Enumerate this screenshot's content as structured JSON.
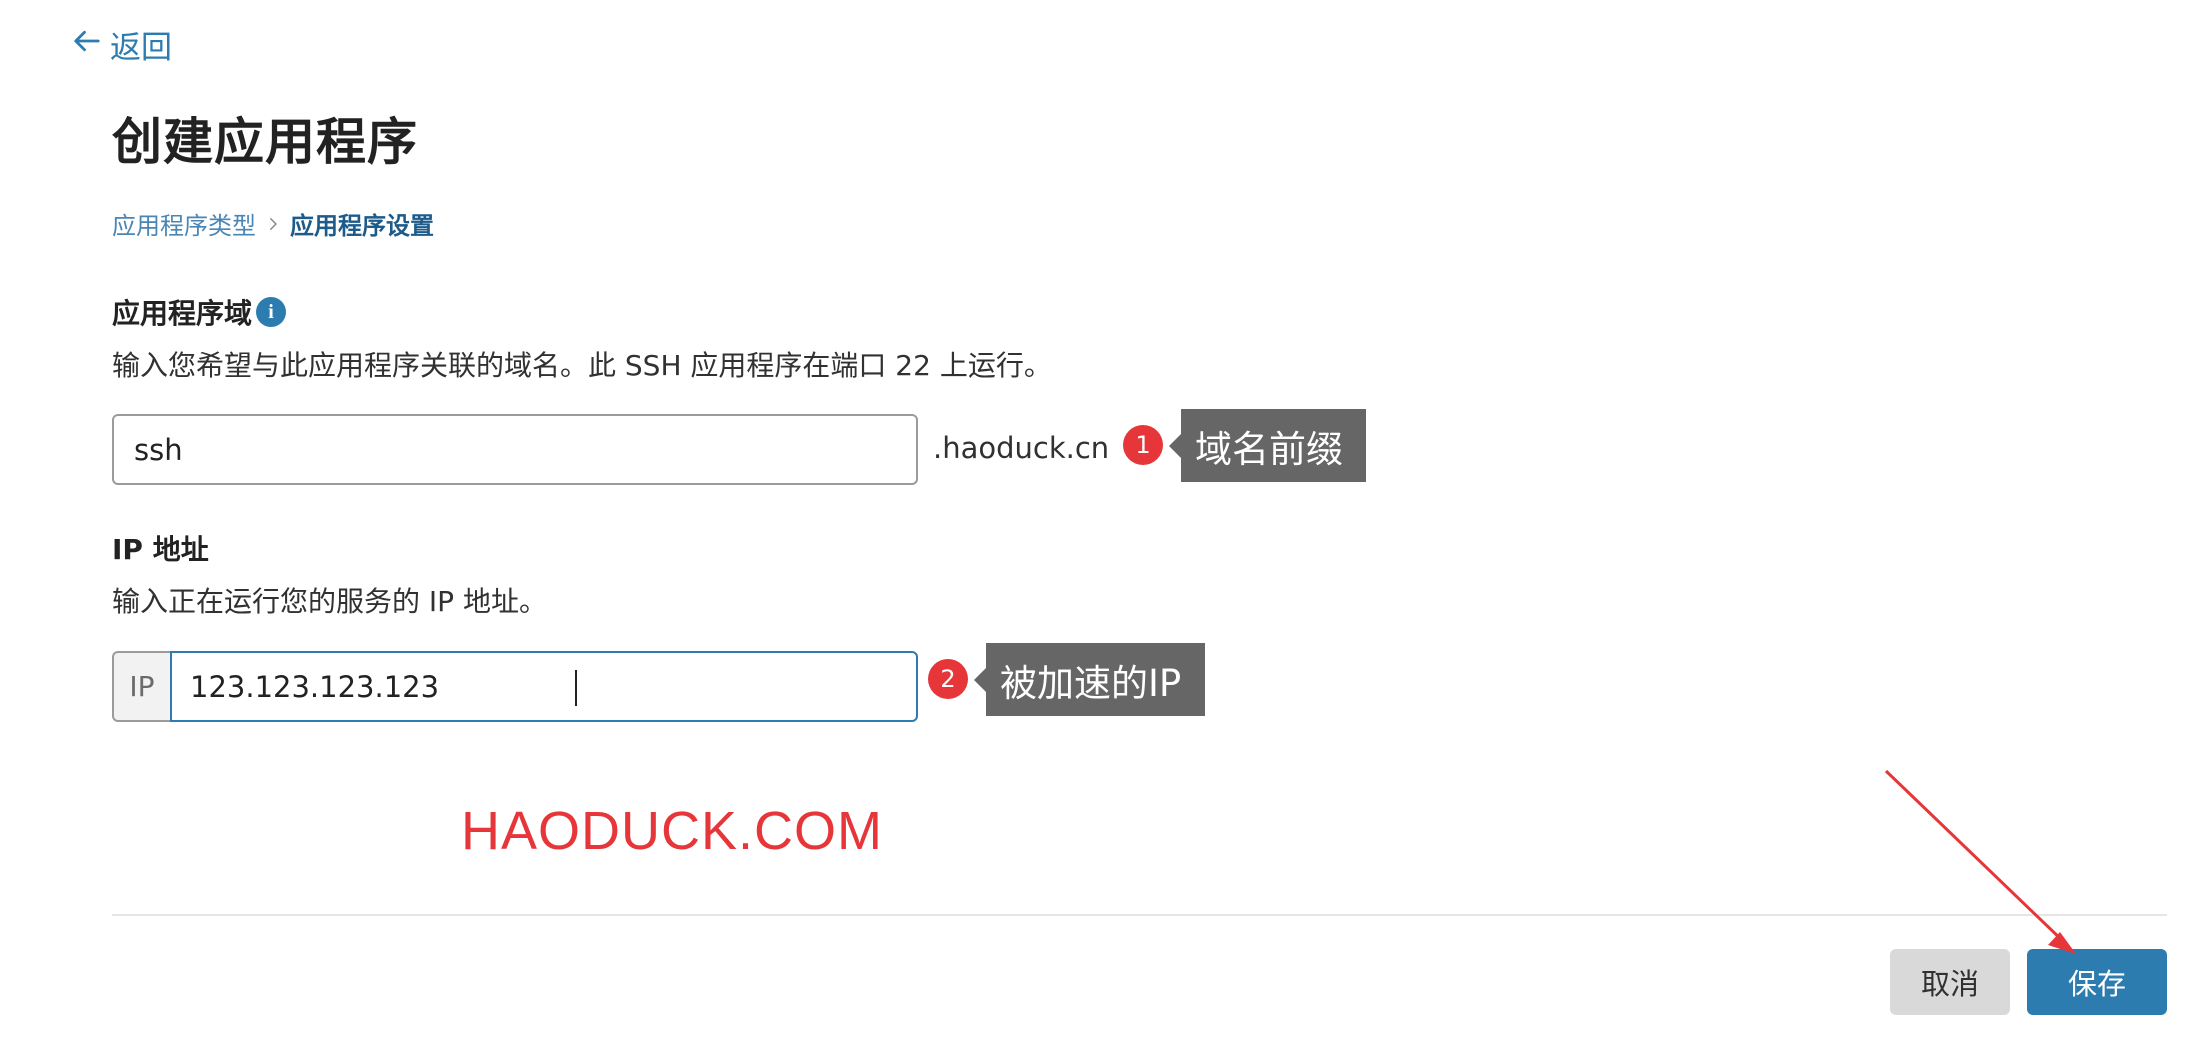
{
  "nav": {
    "back_label": "返回"
  },
  "page": {
    "title": "创建应用程序"
  },
  "breadcrumb": {
    "step1": "应用程序类型",
    "step2": "应用程序设置"
  },
  "domain_section": {
    "label": "应用程序域",
    "info_glyph": "i",
    "description": "输入您希望与此应用程序关联的域名。此 SSH 应用程序在端口 22 上运行。",
    "subdomain_value": "ssh",
    "suffix": ".haoduck.cn"
  },
  "ip_section": {
    "label": "IP 地址",
    "description": "输入正在运行您的服务的 IP 地址。",
    "prefix": "IP",
    "value": "123.123.123.123"
  },
  "annotations": {
    "marker1": "1",
    "callout1": "域名前缀",
    "marker2": "2",
    "callout2": "被加速的IP"
  },
  "watermark": "HAODUCK.COM",
  "footer": {
    "cancel_label": "取消",
    "save_label": "保存"
  },
  "colors": {
    "accent": "#2c7cb0",
    "annotation_red": "#e6363a",
    "callout_bg": "#666666"
  }
}
